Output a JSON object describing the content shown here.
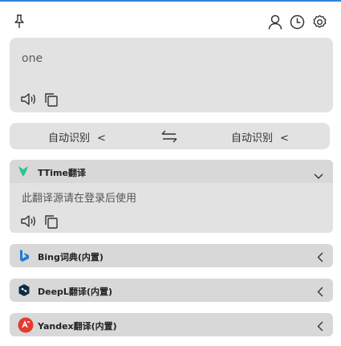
{
  "toolbar": {
    "pin_icon": "pin-icon",
    "user_icon": "user-icon",
    "history_icon": "history-icon",
    "settings_icon": "settings-icon"
  },
  "input": {
    "text": "one",
    "speak_icon": "speaker-icon",
    "copy_icon": "copy-icon"
  },
  "languages": {
    "source": "自动识别",
    "target": "自动识别",
    "swap_icon": "swap-icon"
  },
  "services": [
    {
      "name": "TTime翻译",
      "expanded": true,
      "message": "此翻译源请在登录后使用",
      "logo": "ttime-logo",
      "logo_color": "#2bc48a"
    },
    {
      "name": "Bing词典(内置)",
      "expanded": false,
      "logo": "bing-logo",
      "logo_color": "#1f7bd8"
    },
    {
      "name": "DeepL翻译(内置)",
      "expanded": false,
      "logo": "deepl-logo",
      "logo_color": "#0f2b46"
    },
    {
      "name": "Yandex翻译(内置)",
      "expanded": false,
      "logo": "yandex-logo",
      "logo_color": "#e53a2f"
    }
  ],
  "colors": {
    "accent_top": "#2f86d6",
    "card_bg": "#e2e2e2",
    "service_header_bg": "#d8d8d8"
  }
}
